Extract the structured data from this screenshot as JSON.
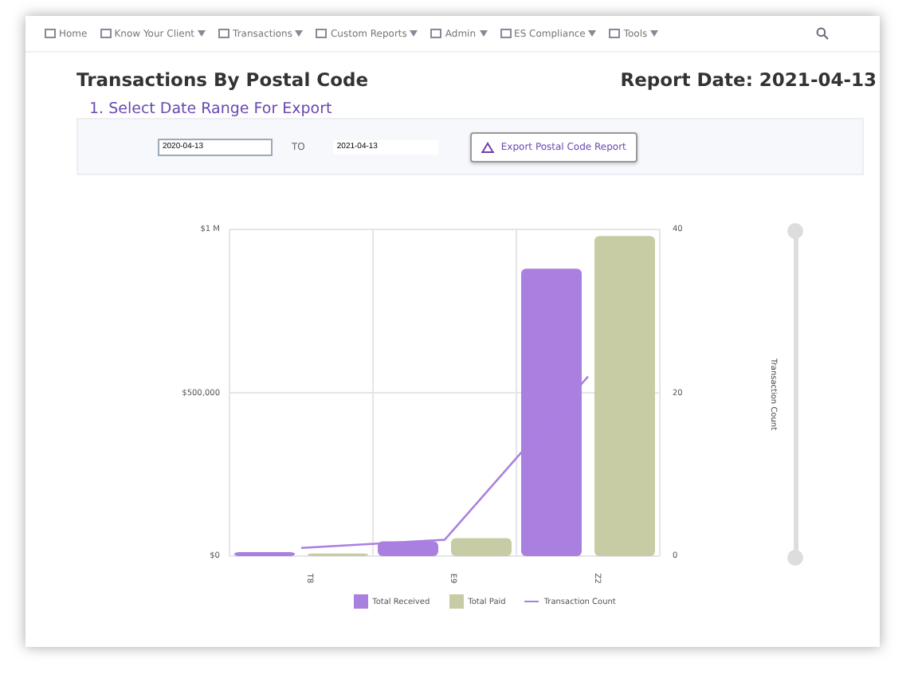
{
  "nav": {
    "items": [
      {
        "label": "Home",
        "dropdown": false
      },
      {
        "label": "Know Your Client",
        "dropdown": true
      },
      {
        "label": "Transactions",
        "dropdown": true
      },
      {
        "label": "Custom Reports",
        "dropdown": true
      },
      {
        "label": "Admin",
        "dropdown": true
      },
      {
        "label": "ES Compliance",
        "dropdown": true
      },
      {
        "label": "Tools",
        "dropdown": true
      }
    ]
  },
  "page_title": "Transactions By Postal Code",
  "report_date": "Report Date: 2021-04-13",
  "section": {
    "title": "1. Select Date Range For Export",
    "from": "2020-04-13",
    "to_label": "TO",
    "to": "2021-04-13",
    "export_button": "Export Postal Code Report"
  },
  "chart": {
    "right_axis_title": "Transaction Count",
    "range_slider": {
      "level": 1
    },
    "chart_data": {
      "type": "bar",
      "categories": [
        "T8",
        "E9",
        "Z2"
      ],
      "series": [
        {
          "name": "Total Received",
          "color": "#a97fe0",
          "values": [
            12000,
            45000,
            880000
          ]
        },
        {
          "name": "Total Paid",
          "color": "#c8cca4",
          "values": [
            8000,
            55000,
            980000
          ]
        },
        {
          "name": "Transaction Count",
          "color": "#a97fe0",
          "axis": "y2",
          "type": "line",
          "values": [
            1,
            2,
            22
          ]
        }
      ],
      "stacked": false,
      "ylim": [
        0,
        1000000
      ],
      "yticks": [
        {
          "value": 0,
          "label": "$0"
        },
        {
          "value": 500000,
          "label": "$500,000"
        },
        {
          "value": 1000000,
          "label": "$1 M"
        }
      ],
      "y2lim": [
        0,
        40
      ],
      "y2ticks": [
        0,
        20,
        40
      ]
    }
  }
}
